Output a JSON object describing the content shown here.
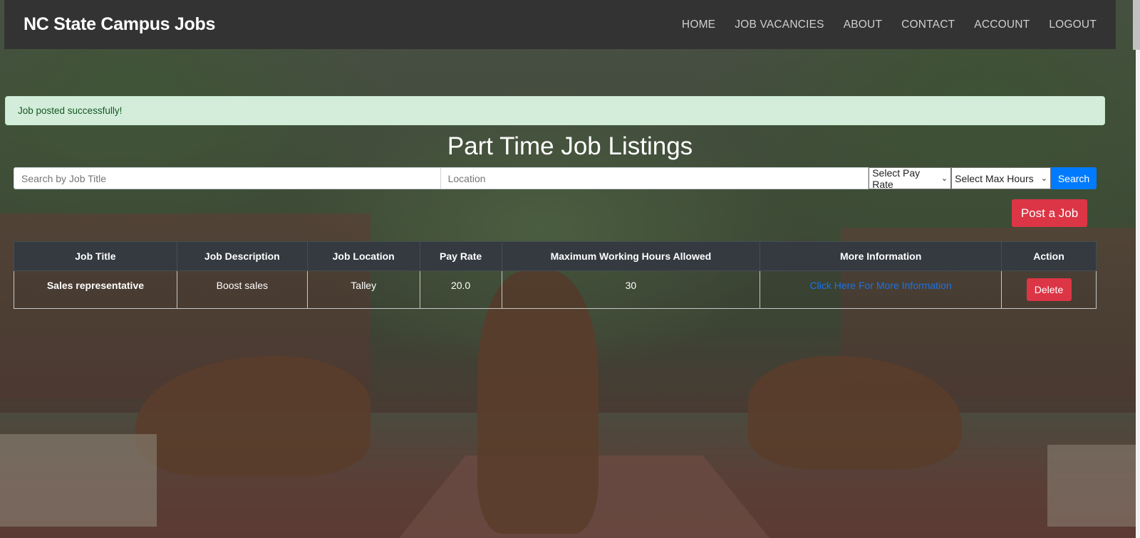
{
  "navbar": {
    "brand": "NC State Campus Jobs",
    "links": [
      "HOME",
      "JOB VACANCIES",
      "ABOUT",
      "CONTACT",
      "ACCOUNT",
      "LOGOUT"
    ]
  },
  "alert": {
    "message": "Job posted successfully!"
  },
  "page_title": "Part Time Job Listings",
  "search": {
    "title_placeholder": "Search by Job Title",
    "location_placeholder": "Location",
    "pay_rate_selected": "Select Pay Rate",
    "max_hours_selected": "Select Max Hours",
    "search_label": "Search"
  },
  "post_job_label": "Post a Job",
  "table": {
    "headers": [
      "Job Title",
      "Job Description",
      "Job Location",
      "Pay Rate",
      "Maximum Working Hours Allowed",
      "More Information",
      "Action"
    ],
    "rows": [
      {
        "title": "Sales representative",
        "description": "Boost sales",
        "location": "Talley",
        "pay_rate": "20.0",
        "max_hours": "30",
        "more_info": "Click Here For More Information",
        "action": "Delete"
      }
    ]
  },
  "colors": {
    "navbar": "#333333",
    "alert_bg": "#d4edda",
    "primary": "#007bff",
    "danger": "#dc3545",
    "table_header": "#343a40"
  }
}
